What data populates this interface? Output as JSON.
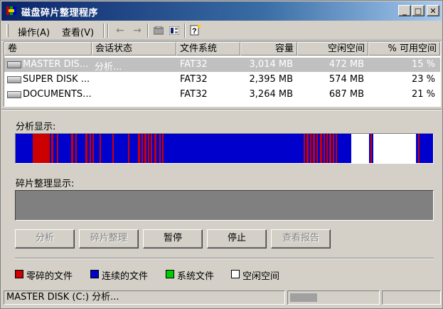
{
  "window": {
    "title": "磁盘碎片整理程序",
    "controls": {
      "minimize": "_",
      "maximize": "□",
      "close": "✕"
    }
  },
  "menu": {
    "action": "操作(A)",
    "view": "查看(V)"
  },
  "toolbar_icons": [
    "back-arrow-icon",
    "forward-arrow-icon",
    "drive-properties-icon",
    "view-icon",
    "help-icon"
  ],
  "list": {
    "columns": [
      "卷",
      "会话状态",
      "文件系统",
      "容量",
      "空闲空间",
      "% 可用空间"
    ],
    "rows": [
      {
        "volume": "MASTER DIS...",
        "status": "分析...",
        "fs": "FAT32",
        "capacity": "3,014 MB",
        "free": "472 MB",
        "pct": "15 %",
        "selected": true
      },
      {
        "volume": "SUPER DISK ...",
        "status": "",
        "fs": "FAT32",
        "capacity": "2,395 MB",
        "free": "574 MB",
        "pct": "23 %",
        "selected": false
      },
      {
        "volume": "DOCUMENTS...",
        "status": "",
        "fs": "FAT32",
        "capacity": "3,264 MB",
        "free": "687 MB",
        "pct": "21 %",
        "selected": false
      }
    ]
  },
  "analysis": {
    "label": "分析显示:"
  },
  "defrag": {
    "label": "碎片整理显示:"
  },
  "buttons": {
    "analyze": "分析",
    "defragment": "碎片整理",
    "pause": "暂停",
    "stop": "停止",
    "view_report": "查看报告"
  },
  "legend": {
    "fragmented": "零碎的文件",
    "contiguous": "连续的文件",
    "system": "系统文件",
    "free": "空闲空间"
  },
  "colors": {
    "fragmented": "#cc0000",
    "contiguous": "#0000cc",
    "system": "#00cc00",
    "free": "#ffffff"
  },
  "status": {
    "text": "MASTER DISK (C:) 分析..."
  }
}
